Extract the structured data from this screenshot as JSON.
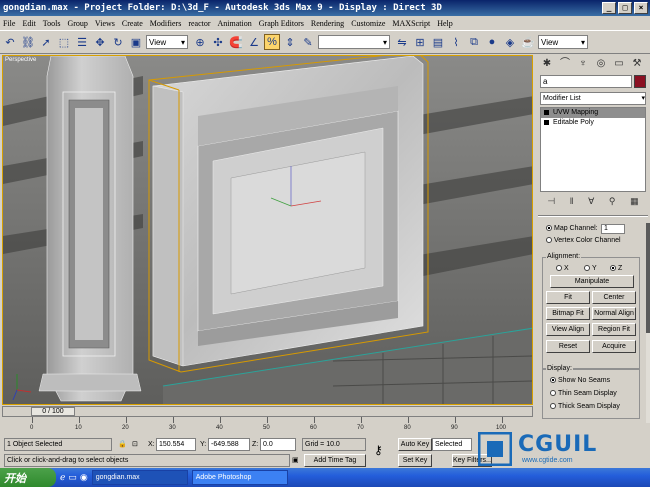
{
  "window": {
    "title": "gongdian.max    - Project Folder: D:\\3d_F    - Autodesk 3ds Max 9    - Display : Direct 3D",
    "controls": [
      "_",
      "□",
      "×"
    ]
  },
  "menu": [
    "File",
    "Edit",
    "Tools",
    "Group",
    "Views",
    "Create",
    "Modifiers",
    "reactor",
    "Animation",
    "Graph Editors",
    "Rendering",
    "Customize",
    "MAXScript",
    "Help"
  ],
  "toolbar": {
    "view_dropdown": "View",
    "view_dropdown_right": "View"
  },
  "viewport": {
    "label": "Perspective"
  },
  "panel": {
    "object_name": "a",
    "modifier_list": "Modifier List",
    "stack": [
      "UVW Mapping",
      "Editable Poly"
    ],
    "map_channel_label": "Map Channel:",
    "map_channel_value": "1",
    "vertex_color_channel": "Vertex Color Channel",
    "alignment_label": "Alignment:",
    "axes": [
      "X",
      "Y",
      "Z"
    ],
    "buttons": {
      "manipulate": "Manipulate",
      "fit": "Fit",
      "center": "Center",
      "bitmap_fit": "Bitmap Fit",
      "normal_align": "Normal Align",
      "view_align": "View Align",
      "region_fit": "Region Fit",
      "reset": "Reset",
      "acquire": "Acquire"
    },
    "display_label": "Display:",
    "display_options": [
      "Show No Seams",
      "Thin Seam Display",
      "Thick Seam Display"
    ]
  },
  "timeline": {
    "slider": "0 / 100",
    "ticks": [
      "0",
      "10",
      "20",
      "30",
      "40",
      "50",
      "60",
      "70",
      "80",
      "90",
      "100"
    ]
  },
  "status": {
    "selection": "1 Object Selected",
    "prompt": "Click or click-and-drag to select objects",
    "x_label": "X:",
    "x_value": "150.554",
    "y_label": "Y:",
    "y_value": "-649.588",
    "z_label": "Z:",
    "z_value": "0.0",
    "grid": "Grid = 10.0",
    "add_time_tag": "Add Time Tag",
    "auto_key": "Auto Key",
    "selected": "Selected",
    "set_key": "Set Key",
    "key_filters": "Key Filters..."
  },
  "taskbar": {
    "start": "开始",
    "tasks": [
      "gongdian.max",
      "Adobe Photoshop"
    ]
  },
  "watermark": {
    "brand": "CGUIL",
    "url": "www.cgtide.com"
  },
  "colors": {
    "object_color": "#8a1022",
    "selection_bbox": "#d79a00"
  }
}
